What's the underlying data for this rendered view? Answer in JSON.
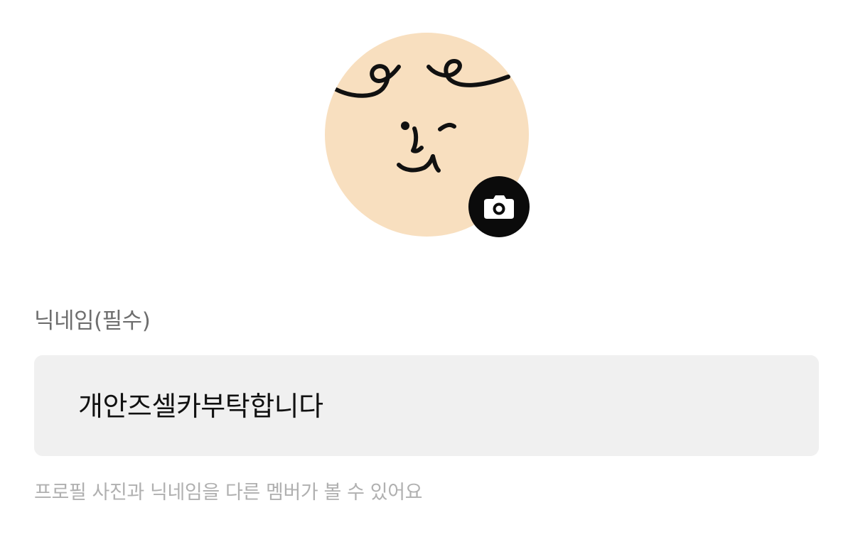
{
  "profile": {
    "avatar_icon": "face-illustration-icon",
    "avatar_color": "#f8dfbf",
    "camera_icon": "camera-icon"
  },
  "nickname": {
    "label": "닉네임(필수)",
    "value": "개안즈셀카부탁합니다",
    "input_bg": "#f0f0f0"
  },
  "helper_text": "프로필 사진과 닉네임을 다른 멤버가 볼 수 있어요"
}
